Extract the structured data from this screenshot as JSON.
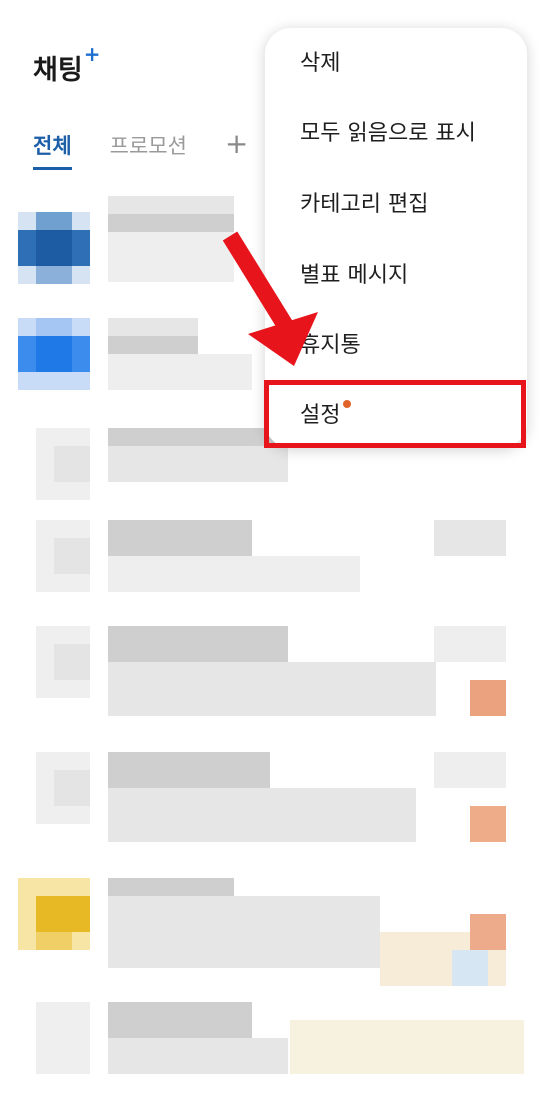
{
  "header": {
    "title": "채팅",
    "title_plus": "+",
    "tabs": [
      {
        "label": "전체",
        "active": true
      },
      {
        "label": "프로모션",
        "active": false
      }
    ],
    "add_tab_label": "+"
  },
  "menu": {
    "items": [
      {
        "label": "삭제"
      },
      {
        "label": "모두 읽음으로 표시"
      },
      {
        "label": "카테고리 편집"
      },
      {
        "label": "별표 메시지"
      },
      {
        "label": "휴지통"
      },
      {
        "label": "설정",
        "badge": "dot"
      }
    ]
  },
  "colors": {
    "accent": "#1c5fa8",
    "highlight": "#e8141b",
    "badge_dot": "#e0632a",
    "arrow": "#e8141b"
  }
}
